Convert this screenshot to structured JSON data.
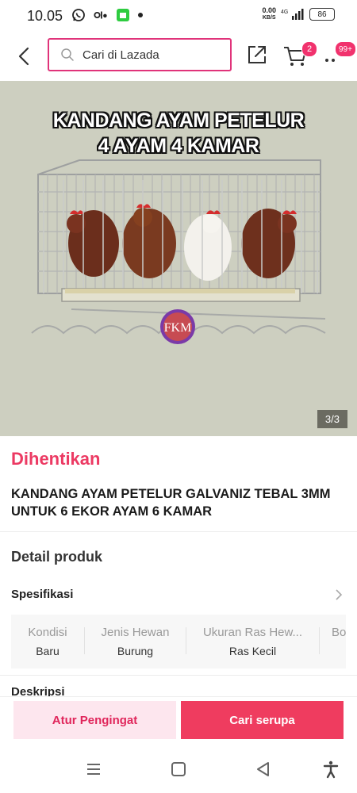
{
  "status_bar": {
    "time": "10.05",
    "net_speed_value": "0.00",
    "net_speed_unit": "KB/S",
    "signal_label": "4G",
    "battery": "86"
  },
  "header": {
    "search_placeholder": "Cari di Lazada",
    "cart_count": "2",
    "notification_count": "99+"
  },
  "product_image": {
    "title_line1": "KANDANG AYAM PETELUR",
    "title_line2": "4 AYAM 4 KAMAR",
    "logo_text": "FKM",
    "page_indicator": "3/3",
    "background_color": "#cdcfc0"
  },
  "product": {
    "status": "Dihentikan",
    "title": "KANDANG AYAM PETELUR GALVANIZ TEBAL 3MM UNTUK 6 EKOR AYAM 6 KAMAR"
  },
  "details": {
    "heading": "Detail produk",
    "spec_heading": "Spesifikasi",
    "specs": [
      {
        "name": "Kondisi",
        "value": "Baru"
      },
      {
        "name": "Jenis Hewan",
        "value": "Burung"
      },
      {
        "name": "Ukuran Ras Hew...",
        "value": "Ras Kecil"
      },
      {
        "name": "Bo",
        "value": ""
      }
    ],
    "description_heading": "Deskripsi"
  },
  "actions": {
    "remind_label": "Atur Pengingat",
    "similar_label": "Cari serupa"
  },
  "colors": {
    "accent": "#ef3c5f",
    "status_red": "#ec3a63",
    "search_border": "#e0337a"
  }
}
